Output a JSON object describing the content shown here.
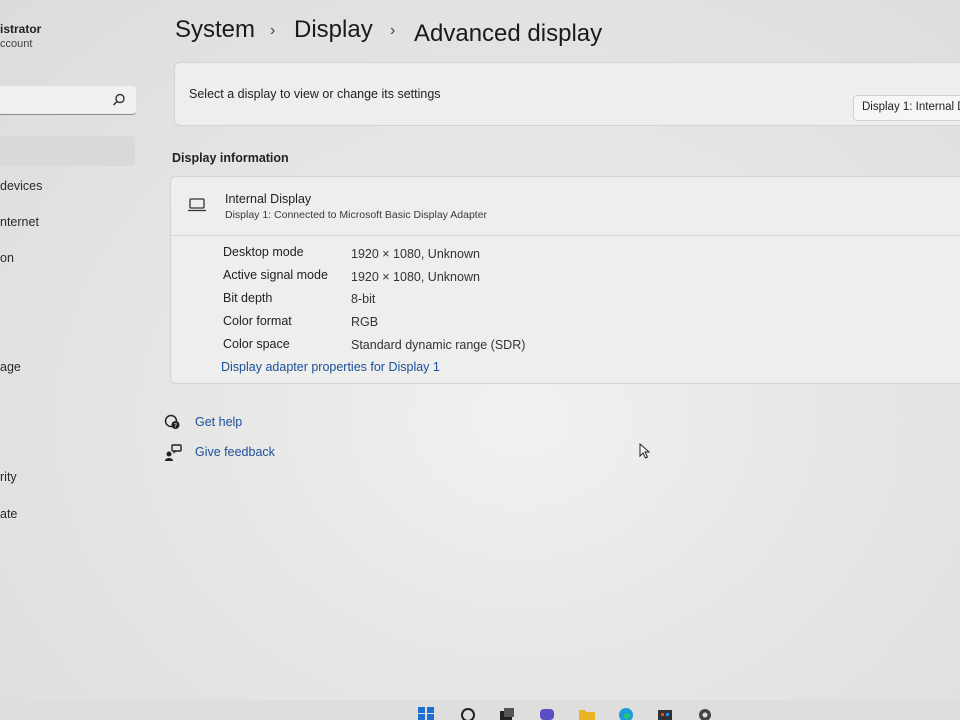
{
  "sidebar": {
    "user_name": "istrator",
    "user_sub": "ccount",
    "search_placeholder": "",
    "items": [
      {
        "label": "",
        "selected": true
      },
      {
        "label": " devices"
      },
      {
        "label": "nternet"
      },
      {
        "label": "on"
      },
      {
        "label": "age"
      },
      {
        "label": "rity"
      },
      {
        "label": "ate"
      }
    ]
  },
  "breadcrumb": {
    "level1": "System",
    "level2": "Display",
    "current": "Advanced display",
    "separator": "›"
  },
  "select_display": {
    "label": "Select a display to view or change its settings",
    "dropdown_value": "Display 1: Internal D"
  },
  "display_information": {
    "section_title": "Display information",
    "display_name": "Internal Display",
    "display_sub": "Display 1: Connected to Microsoft Basic Display Adapter",
    "rows": [
      {
        "label": "Desktop mode",
        "value": "1920 × 1080, Unknown"
      },
      {
        "label": "Active signal mode",
        "value": "1920 × 1080, Unknown"
      },
      {
        "label": "Bit depth",
        "value": "8-bit"
      },
      {
        "label": "Color format",
        "value": "RGB"
      },
      {
        "label": "Color space",
        "value": "Standard dynamic range (SDR)"
      }
    ],
    "adapter_link": "Display adapter properties for Display 1"
  },
  "help": {
    "get_help": "Get help",
    "give_feedback": "Give feedback"
  },
  "icons": {
    "search": "search-icon",
    "monitor": "monitor-icon",
    "help": "help-icon",
    "feedback": "feedback-icon"
  },
  "colors": {
    "link": "#1c4f9c",
    "background": "#e6e6e4",
    "card": "#eeeeec"
  }
}
